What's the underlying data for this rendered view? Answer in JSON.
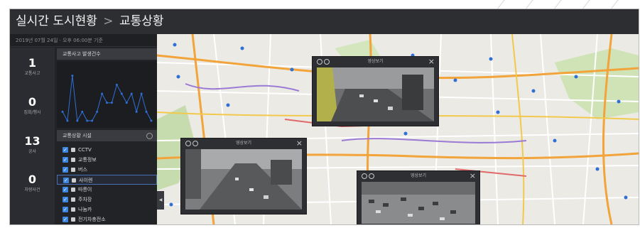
{
  "header": {
    "title_main": "실시간 도시현황",
    "title_sep": ">",
    "title_sub": "교통상황"
  },
  "date_text": "2019년 07월 24일 · 오후 06:00분 기준",
  "stats": [
    {
      "value": "1",
      "label": "교통사고"
    },
    {
      "value": "0",
      "label": "집회/행사"
    },
    {
      "value": "13",
      "label": "공사"
    },
    {
      "value": "0",
      "label": "차량사건"
    }
  ],
  "accident_panel": {
    "title": "교통사고 발생건수"
  },
  "chart_data": {
    "type": "line",
    "values": [
      1,
      0,
      5,
      0,
      1,
      0,
      0,
      1,
      3,
      2,
      2,
      4,
      3,
      2,
      3,
      1,
      3,
      1,
      0
    ],
    "ylim": [
      0,
      6
    ],
    "grid": false,
    "series_color": "#2f6fd6"
  },
  "facility_panel": {
    "title": "교통상황 시설",
    "items": [
      {
        "label": "CCTV",
        "icon": "cctv-icon",
        "checked": true,
        "active": false
      },
      {
        "label": "교통정보",
        "icon": "traffic-info-icon",
        "checked": true,
        "active": false
      },
      {
        "label": "버스",
        "icon": "bus-icon",
        "checked": true,
        "active": false
      },
      {
        "label": "사이렌",
        "icon": "siren-icon",
        "checked": true,
        "active": true
      },
      {
        "label": "따릉이",
        "icon": "bike-icon",
        "checked": true,
        "active": false
      },
      {
        "label": "주차장",
        "icon": "parking-icon",
        "checked": true,
        "active": false
      },
      {
        "label": "나눔카",
        "icon": "car-share-icon",
        "checked": true,
        "active": false
      },
      {
        "label": "전기차충전소",
        "icon": "ev-charger-icon",
        "checked": true,
        "active": false
      }
    ]
  },
  "video_windows": [
    {
      "title": "영상보기"
    },
    {
      "title": "영상보기"
    },
    {
      "title": "영상보기"
    }
  ],
  "colors": {
    "accent": "#3d86e0",
    "panel_bg": "#222327",
    "header_bg": "#2d2e32",
    "map_road_major": "#f2a33a",
    "map_road_minor": "#ffffff"
  }
}
